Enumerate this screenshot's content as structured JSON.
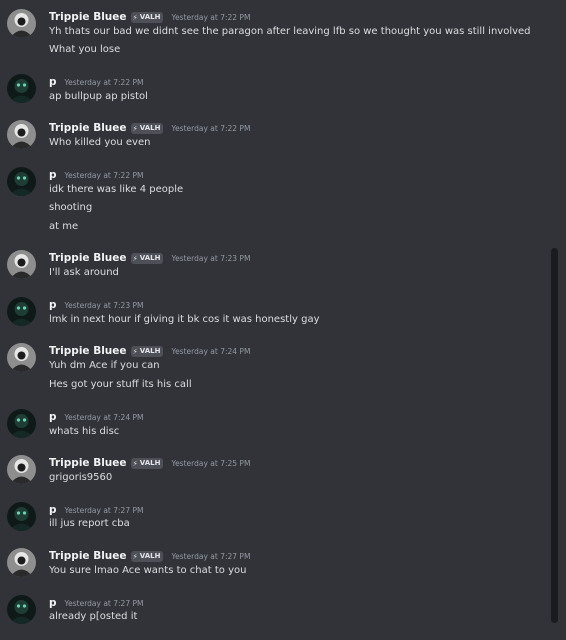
{
  "users": {
    "trippie": {
      "name": "Trippie Bluee",
      "badge": "VALH"
    },
    "p": {
      "name": "p"
    }
  },
  "messages": [
    {
      "author": "Trippie Bluee",
      "badge": "VALH",
      "timestamp": "Yesterday at 7:22 PM",
      "lines": [
        "Yh thats our bad we didnt see the paragon after leaving lfb so we thought you was still involved",
        "What you lose"
      ]
    },
    {
      "author": "p",
      "timestamp": "Yesterday at 7:22 PM",
      "lines": [
        "ap bullpup ap pistol"
      ]
    },
    {
      "author": "Trippie Bluee",
      "badge": "VALH",
      "timestamp": "Yesterday at 7:22 PM",
      "lines": [
        "Who killed you even"
      ]
    },
    {
      "author": "p",
      "timestamp": "Yesterday at 7:22 PM",
      "lines": [
        "idk there was like 4 people",
        "shooting",
        "at me"
      ]
    },
    {
      "author": "Trippie Bluee",
      "badge": "VALH",
      "timestamp": "Yesterday at 7:23 PM",
      "lines": [
        "I'll ask around"
      ]
    },
    {
      "author": "p",
      "timestamp": "Yesterday at 7:23 PM",
      "lines": [
        "lmk in next hour if giving it bk cos it was honestly gay"
      ]
    },
    {
      "author": "Trippie Bluee",
      "badge": "VALH",
      "timestamp": "Yesterday at 7:24 PM",
      "lines": [
        "Yuh dm Ace if you can",
        "Hes got your stuff its his call"
      ]
    },
    {
      "author": "p",
      "timestamp": "Yesterday at 7:24 PM",
      "lines": [
        "whats his disc"
      ]
    },
    {
      "author": "Trippie Bluee",
      "badge": "VALH",
      "timestamp": "Yesterday at 7:25 PM",
      "lines": [
        "grigoris9560"
      ]
    },
    {
      "author": "p",
      "timestamp": "Yesterday at 7:27 PM",
      "lines": [
        "ill jus report cba"
      ]
    },
    {
      "author": "Trippie Bluee",
      "badge": "VALH",
      "timestamp": "Yesterday at 7:27 PM",
      "lines": [
        "You sure lmao Ace wants to chat to you"
      ]
    },
    {
      "author": "p",
      "timestamp": "Yesterday at 7:27 PM",
      "lines": [
        "already p[osted it"
      ]
    }
  ],
  "colors": {
    "background": "#313338",
    "author": "#f2f3f5",
    "text": "#dbdee1",
    "timestamp": "#949ba4",
    "badge_bg": "#4e5058"
  },
  "icons": {
    "badge": "lightning-bolt-icon",
    "trippie_avatar": "pale-figure-avatar",
    "p_avatar": "dark-green-figure-avatar"
  }
}
